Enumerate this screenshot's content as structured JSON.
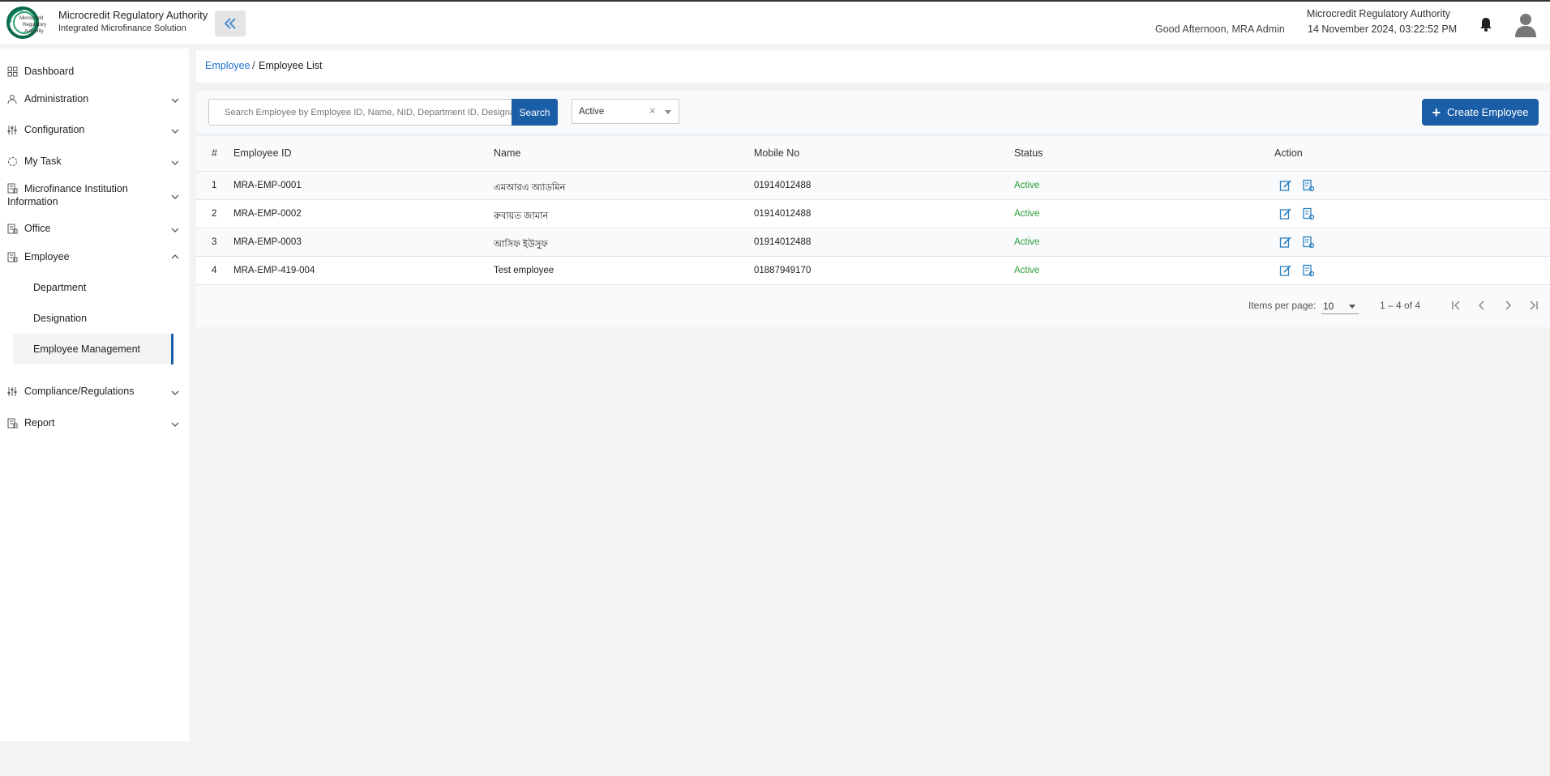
{
  "header": {
    "brand_title": "Microcredit Regulatory Authority",
    "brand_subtitle": "Integrated Microfinance Solution",
    "logo_text": [
      "Microcredit",
      "Regulatory",
      "Authority"
    ],
    "greeting": "Good Afternoon, MRA Admin",
    "org_name": "Microcredit Regulatory Authority",
    "datetime": "14 November 2024, 03:22:52 PM",
    "icons": {
      "collapse": "double-chevron-left-icon",
      "notifications": "bell-icon",
      "profile": "user-avatar-icon"
    }
  },
  "sidebar": {
    "items": [
      {
        "label": "Dashboard",
        "icon": "grid-icon",
        "expandable": false
      },
      {
        "label": "Administration",
        "icon": "admin-user-icon",
        "expandable": true
      },
      {
        "label": "Configuration",
        "icon": "sliders-icon",
        "expandable": true
      },
      {
        "label": "My Task",
        "icon": "task-circle-icon",
        "expandable": true
      },
      {
        "label": "Microfinance Institution Information",
        "icon": "building-icon",
        "expandable": true
      },
      {
        "label": "Office",
        "icon": "office-icon",
        "expandable": true
      },
      {
        "label": "Employee",
        "icon": "employee-icon",
        "expandable": true,
        "expanded": true,
        "children": [
          "Department",
          "Designation",
          "Employee Management"
        ],
        "active_child": "Employee Management"
      },
      {
        "label": "Compliance/Regulations",
        "icon": "sliders-icon",
        "expandable": true
      },
      {
        "label": "Report",
        "icon": "report-icon",
        "expandable": true
      }
    ]
  },
  "breadcrumb": {
    "parent": "Employee",
    "separator": "/",
    "current": "Employee List"
  },
  "toolbar": {
    "search_placeholder": "Search Employee by Employee ID, Name, NID, Department ID, Designation",
    "search_button": "Search",
    "status_filter": "Active",
    "clear_symbol": "×",
    "create_button": "Create Employee",
    "create_plus": "+"
  },
  "table": {
    "columns": [
      "#",
      "Employee ID",
      "Name",
      "Mobile No",
      "Status",
      "Action"
    ],
    "rows": [
      {
        "no": "1",
        "employee_id": "MRA-EMP-0001",
        "name": "এমআরএ অ্যাডমিন",
        "mobile": "01914012488",
        "status": "Active"
      },
      {
        "no": "2",
        "employee_id": "MRA-EMP-0002",
        "name": "রুবায়ত জামান",
        "mobile": "01914012488",
        "status": "Active"
      },
      {
        "no": "3",
        "employee_id": "MRA-EMP-0003",
        "name": "আসিফ ইউসুফ",
        "mobile": "01914012488",
        "status": "Active"
      },
      {
        "no": "4",
        "employee_id": "MRA-EMP-419-004",
        "name": "Test employee",
        "mobile": "01887949170",
        "status": "Active"
      }
    ],
    "action_icons": [
      "edit-icon",
      "view-details-icon"
    ]
  },
  "pagination": {
    "items_per_page_label": "Items per page:",
    "items_per_page": "10",
    "range": "1 – 4 of 4",
    "buttons": [
      "first-page-icon",
      "prev-page-icon",
      "next-page-icon",
      "last-page-icon"
    ]
  },
  "colors": {
    "primary": "#1a5ea7",
    "link": "#1f6fd0",
    "status_active": "#2a9d3a",
    "icon": "#2a7fc0"
  }
}
